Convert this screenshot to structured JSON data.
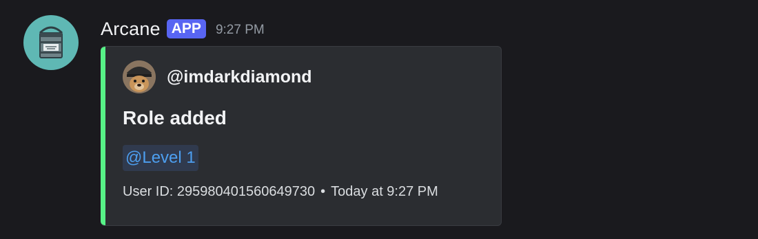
{
  "message": {
    "username": "Arcane",
    "badge": "APP",
    "timestamp": "9:27 PM"
  },
  "embed": {
    "author": "@imdarkdiamond",
    "title": "Role added",
    "role_mention": "@Level 1",
    "footer": {
      "user_id": "User ID: 295980401560649730",
      "separator": "•",
      "time": "Today at 9:27 PM"
    }
  },
  "colors": {
    "background": "#1a1a1e",
    "embed_background": "#2b2d31",
    "embed_accent": "#57f287",
    "badge": "#5865f2",
    "mention_text": "#4d9ff0",
    "avatar_bg": "#5fb8b4"
  }
}
